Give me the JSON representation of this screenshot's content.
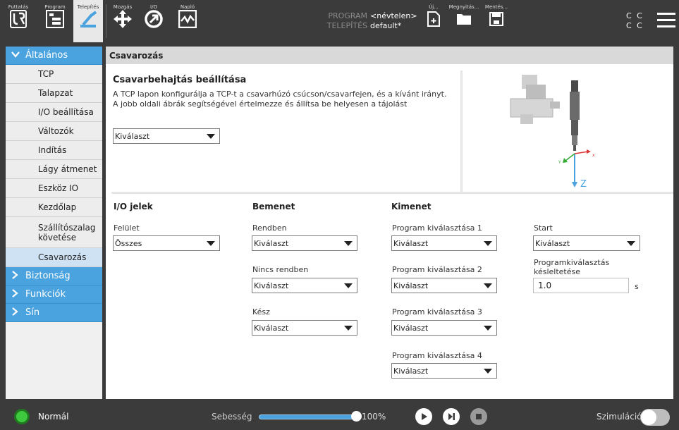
{
  "topbar": {
    "buttons": [
      {
        "label": "Futtatás",
        "icon": "ur-logo-icon"
      },
      {
        "label": "Program",
        "icon": "program-icon"
      },
      {
        "label": "Telepítés",
        "icon": "installation-icon"
      },
      {
        "label": "Mozgás",
        "icon": "move-icon"
      },
      {
        "label": "I/O",
        "icon": "io-icon"
      },
      {
        "label": "Napló",
        "icon": "log-icon"
      }
    ],
    "program_key": "PROGRAM",
    "program_value": "<névtelen>",
    "install_key": "TELEPÍTÉS",
    "install_value": "default*",
    "file_buttons": [
      {
        "label": "Új...",
        "icon": "new-file-icon"
      },
      {
        "label": "Megnyitás...",
        "icon": "folder-icon"
      },
      {
        "label": "Mentés...",
        "icon": "save-icon"
      }
    ],
    "cc_line1": "C C",
    "cc_line2": "C C"
  },
  "sidebar": {
    "groups": [
      {
        "label": "Általános",
        "expanded": true
      },
      {
        "label": "Biztonság",
        "expanded": false
      },
      {
        "label": "Funkciók",
        "expanded": false
      },
      {
        "label": "Sín",
        "expanded": false
      }
    ],
    "items": [
      {
        "label": "TCP"
      },
      {
        "label": "Talapzat"
      },
      {
        "label": "I/O beállítása"
      },
      {
        "label": "Változók"
      },
      {
        "label": "Indítás"
      },
      {
        "label": "Lágy átmenet"
      },
      {
        "label": "Eszköz IO"
      },
      {
        "label": "Kezdőlap"
      },
      {
        "label": "Szállítószalag követése"
      },
      {
        "label": "Csavarozás",
        "active": true
      }
    ]
  },
  "main": {
    "title": "Csavarozás",
    "setup_title": "Csavarbehajtás beállítása",
    "setup_desc": "A TCP lapon konfigurálja a TCP-t a csavarhúzó csúcson/csavarfejen, és a kívánt irányt. A jobb oldali ábrák segítségével értelmezze és állítsa be helyesen a tájolást",
    "direction_select": "Kiválaszt",
    "axis_label": "Z",
    "io_header": "I/O jelek",
    "input_header": "Bemenet",
    "output_header": "Kimenet",
    "interface_label": "Felület",
    "interface_value": "Összes",
    "inputs": [
      {
        "label": "Rendben",
        "value": "Kiválaszt"
      },
      {
        "label": "Nincs rendben",
        "value": "Kiválaszt"
      },
      {
        "label": "Kész",
        "value": "Kiválaszt"
      }
    ],
    "outputs": [
      {
        "label": "Program kiválasztása 1",
        "value": "Kiválaszt"
      },
      {
        "label": "Program kiválasztása 2",
        "value": "Kiválaszt"
      },
      {
        "label": "Program kiválasztása 3",
        "value": "Kiválaszt"
      },
      {
        "label": "Program kiválasztása 4",
        "value": "Kiválaszt"
      }
    ],
    "start_label": "Start",
    "start_value": "Kiválaszt",
    "delay_label": "Programkiválasztás késleltetése",
    "delay_value": "1.0",
    "delay_unit": "s"
  },
  "bottombar": {
    "status": "Normál",
    "status_color": "#3ec93e",
    "speed_label": "Sebesség",
    "speed_value": "100%",
    "speed_fraction": 1.0,
    "sim_label": "Szimuláció",
    "accent": "#4aa3df"
  }
}
